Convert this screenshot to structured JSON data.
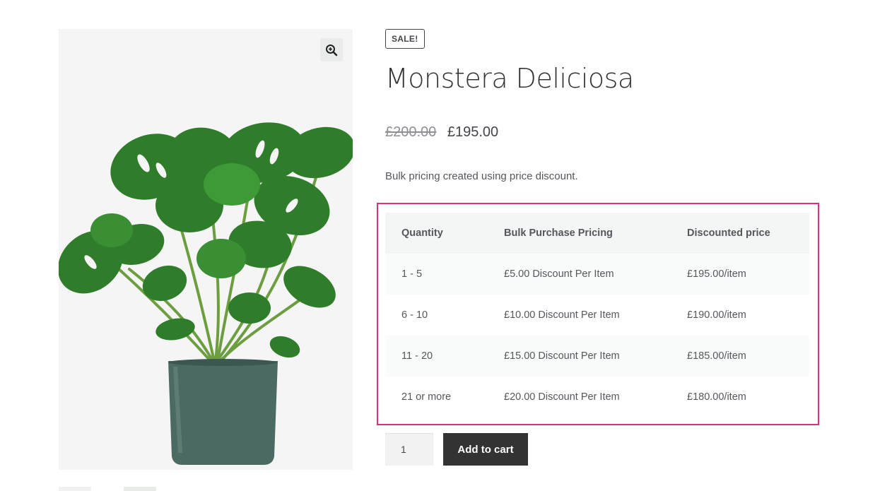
{
  "product": {
    "sale_badge": "SALE!",
    "title": "Monstera Deliciosa",
    "price_old": "£200.00",
    "price_new": "£195.00",
    "short_description": "Bulk pricing created using price discount."
  },
  "pricing_table": {
    "headers": [
      "Quantity",
      "Bulk Purchase Pricing",
      "Discounted price"
    ],
    "rows": [
      [
        "1 - 5",
        "£5.00 Discount Per Item",
        "£195.00/item"
      ],
      [
        "6 - 10",
        "£10.00 Discount Per Item",
        "£190.00/item"
      ],
      [
        "11 - 20",
        "£15.00 Discount Per Item",
        "£185.00/item"
      ],
      [
        "21 or more",
        "£20.00 Discount Per Item",
        "£180.00/item"
      ]
    ]
  },
  "cart": {
    "quantity_value": "1",
    "add_to_cart_label": "Add to cart"
  },
  "icons": {
    "zoom": "zoom-in-icon"
  },
  "colors": {
    "highlight_border": "#de2f7e",
    "button_bg": "#333333",
    "leaf_green": "#2f7d2b",
    "pot": "#4b6a63"
  }
}
